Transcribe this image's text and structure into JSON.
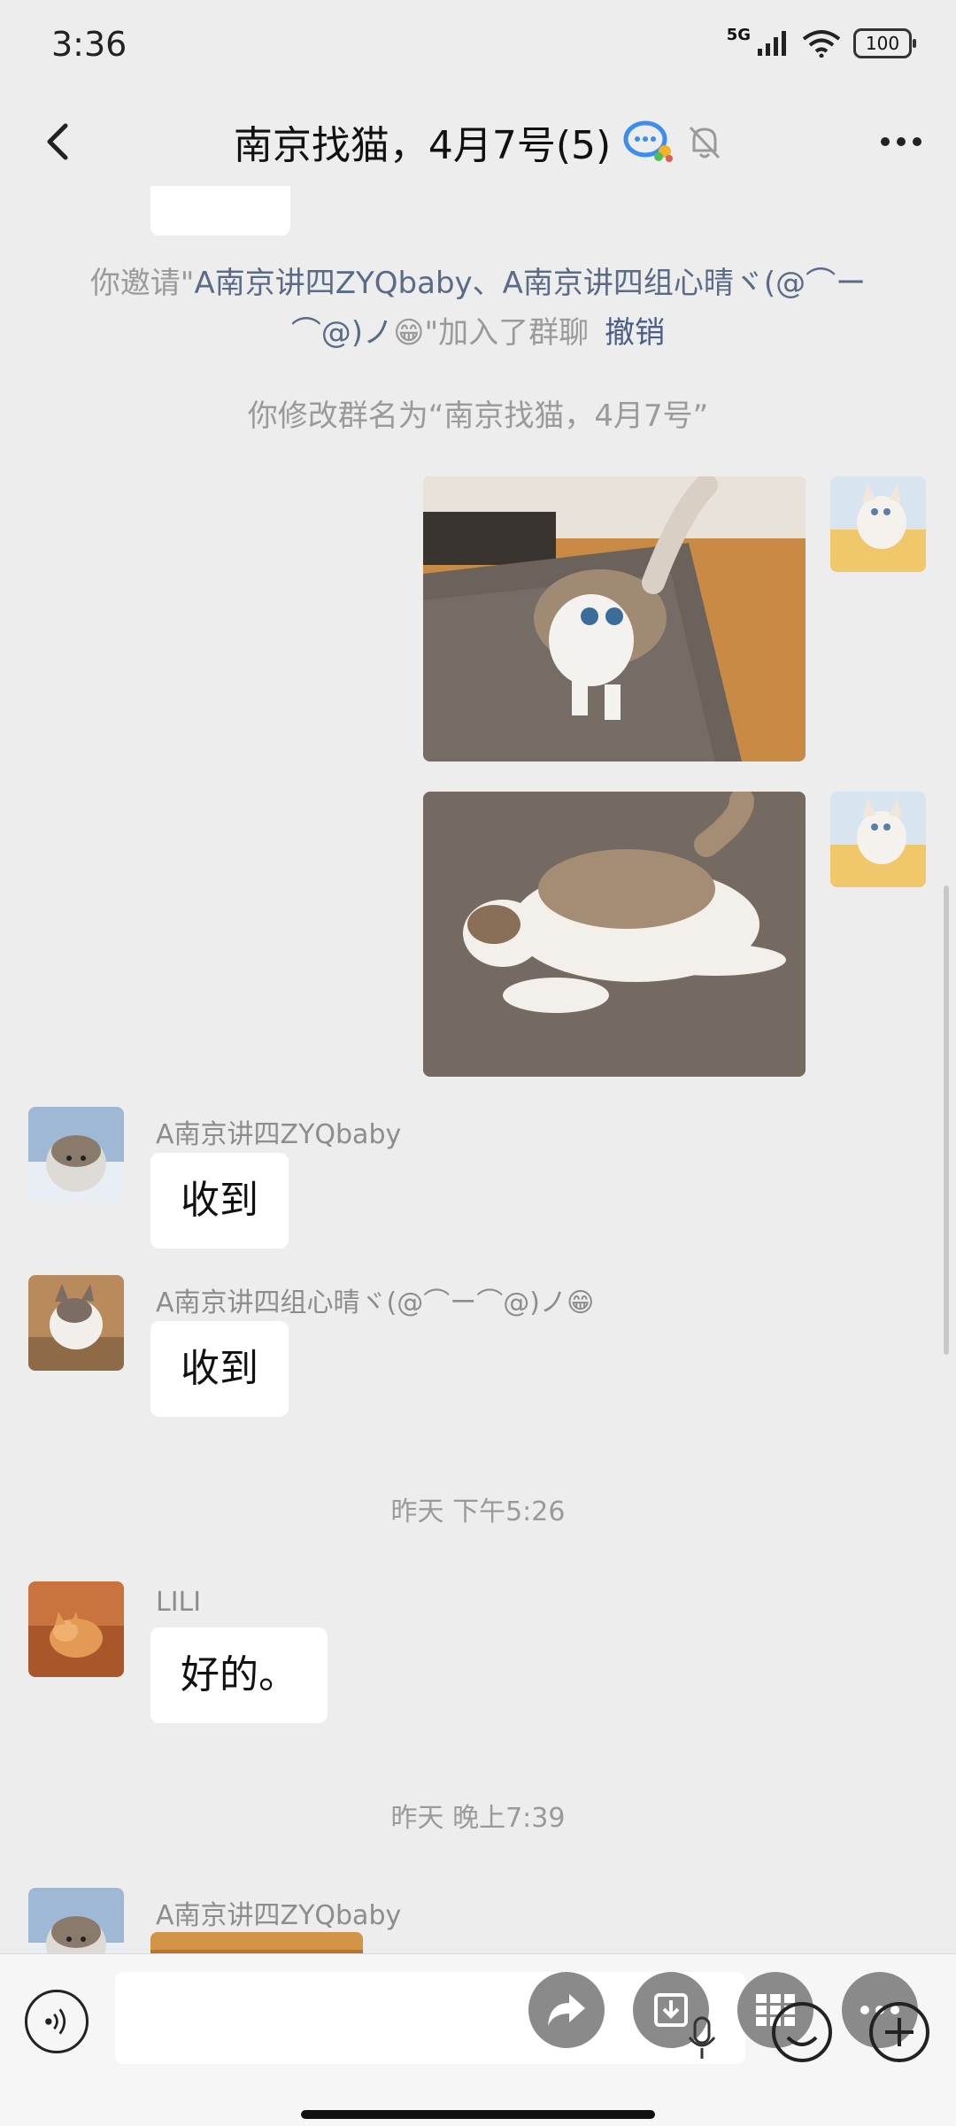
{
  "status_bar": {
    "time": "3:36",
    "network": "5G",
    "battery": "100"
  },
  "header": {
    "title": "南京找猫，4月7号(5)"
  },
  "messages": {
    "invite_prefix": "你邀请\"",
    "invite_names": "A南京讲四ZYQbaby、A南京讲四组心晴ヾ(@⌒ー⌒@)ノ",
    "invite_emoji": "😁",
    "invite_suffix": "\"加入了群聊",
    "revoke": "撤销",
    "rename_notice": "你修改群名为“南京找猫，4月7号”",
    "msg1": {
      "sender": "A南京讲四ZYQbaby",
      "text": "收到"
    },
    "msg2": {
      "sender": "A南京讲四组心晴ヾ(@⌒ー⌒@)ノ",
      "sender_emoji": "😁",
      "text": "收到"
    },
    "time1": "昨天 下午5:26",
    "msg3": {
      "sender": "LILI",
      "text": "好的。"
    },
    "time2": "昨天 晚上7:39",
    "msg4": {
      "sender": "A南京讲四ZYQbaby"
    }
  },
  "icons": {
    "back": "chevron-left-icon",
    "more": "more-icon",
    "mute": "bell-off-icon",
    "voice": "voice-icon",
    "share": "share-icon",
    "download": "download-icon",
    "grid": "grid-icon",
    "emoji": "emoji-icon",
    "plus": "plus-icon"
  },
  "colors": {
    "background": "#ededed",
    "bubble": "#ffffff",
    "link": "#4a5e84"
  }
}
